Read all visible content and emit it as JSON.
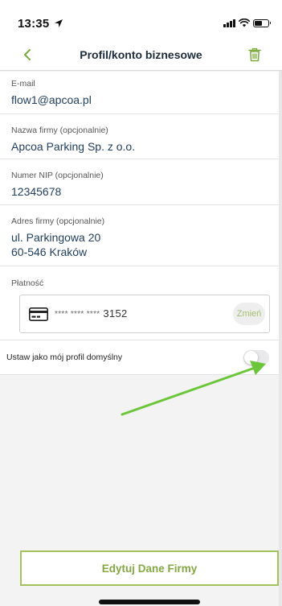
{
  "status_bar": {
    "time": "13:35",
    "battery_level": 0.55
  },
  "nav": {
    "title": "Profil/konto biznesowe",
    "back_icon": "chevron-left-icon",
    "delete_icon": "trash-icon"
  },
  "fields": {
    "email": {
      "label": "E-mail",
      "value": "flow1@apcoa.pl"
    },
    "company_name": {
      "label": "Nazwa firmy (opcjonalnie)",
      "value": "Apcoa Parking Sp. z o.o."
    },
    "nip": {
      "label": "Numer NIP (opcjonalnie)",
      "value": "12345678"
    },
    "address": {
      "label": "Adres firmy (opcjonalnie)",
      "line1": "ul. Parkingowa 20",
      "line2": "60-546 Kraków"
    }
  },
  "payment": {
    "label": "Płatność",
    "card_masked": "**** **** ****",
    "card_last4": "3152",
    "change_label": "Zmień",
    "card_icon": "credit-card-icon"
  },
  "default_profile": {
    "label": "Ustaw jako mój profil domyślny",
    "enabled": false
  },
  "edit_button": {
    "label": "Edytuj Dane Firmy"
  },
  "colors": {
    "accent_green": "#83a843",
    "button_border": "#a3c25b",
    "text_navy": "#213f5e",
    "arrow_green": "#6cc63a"
  }
}
